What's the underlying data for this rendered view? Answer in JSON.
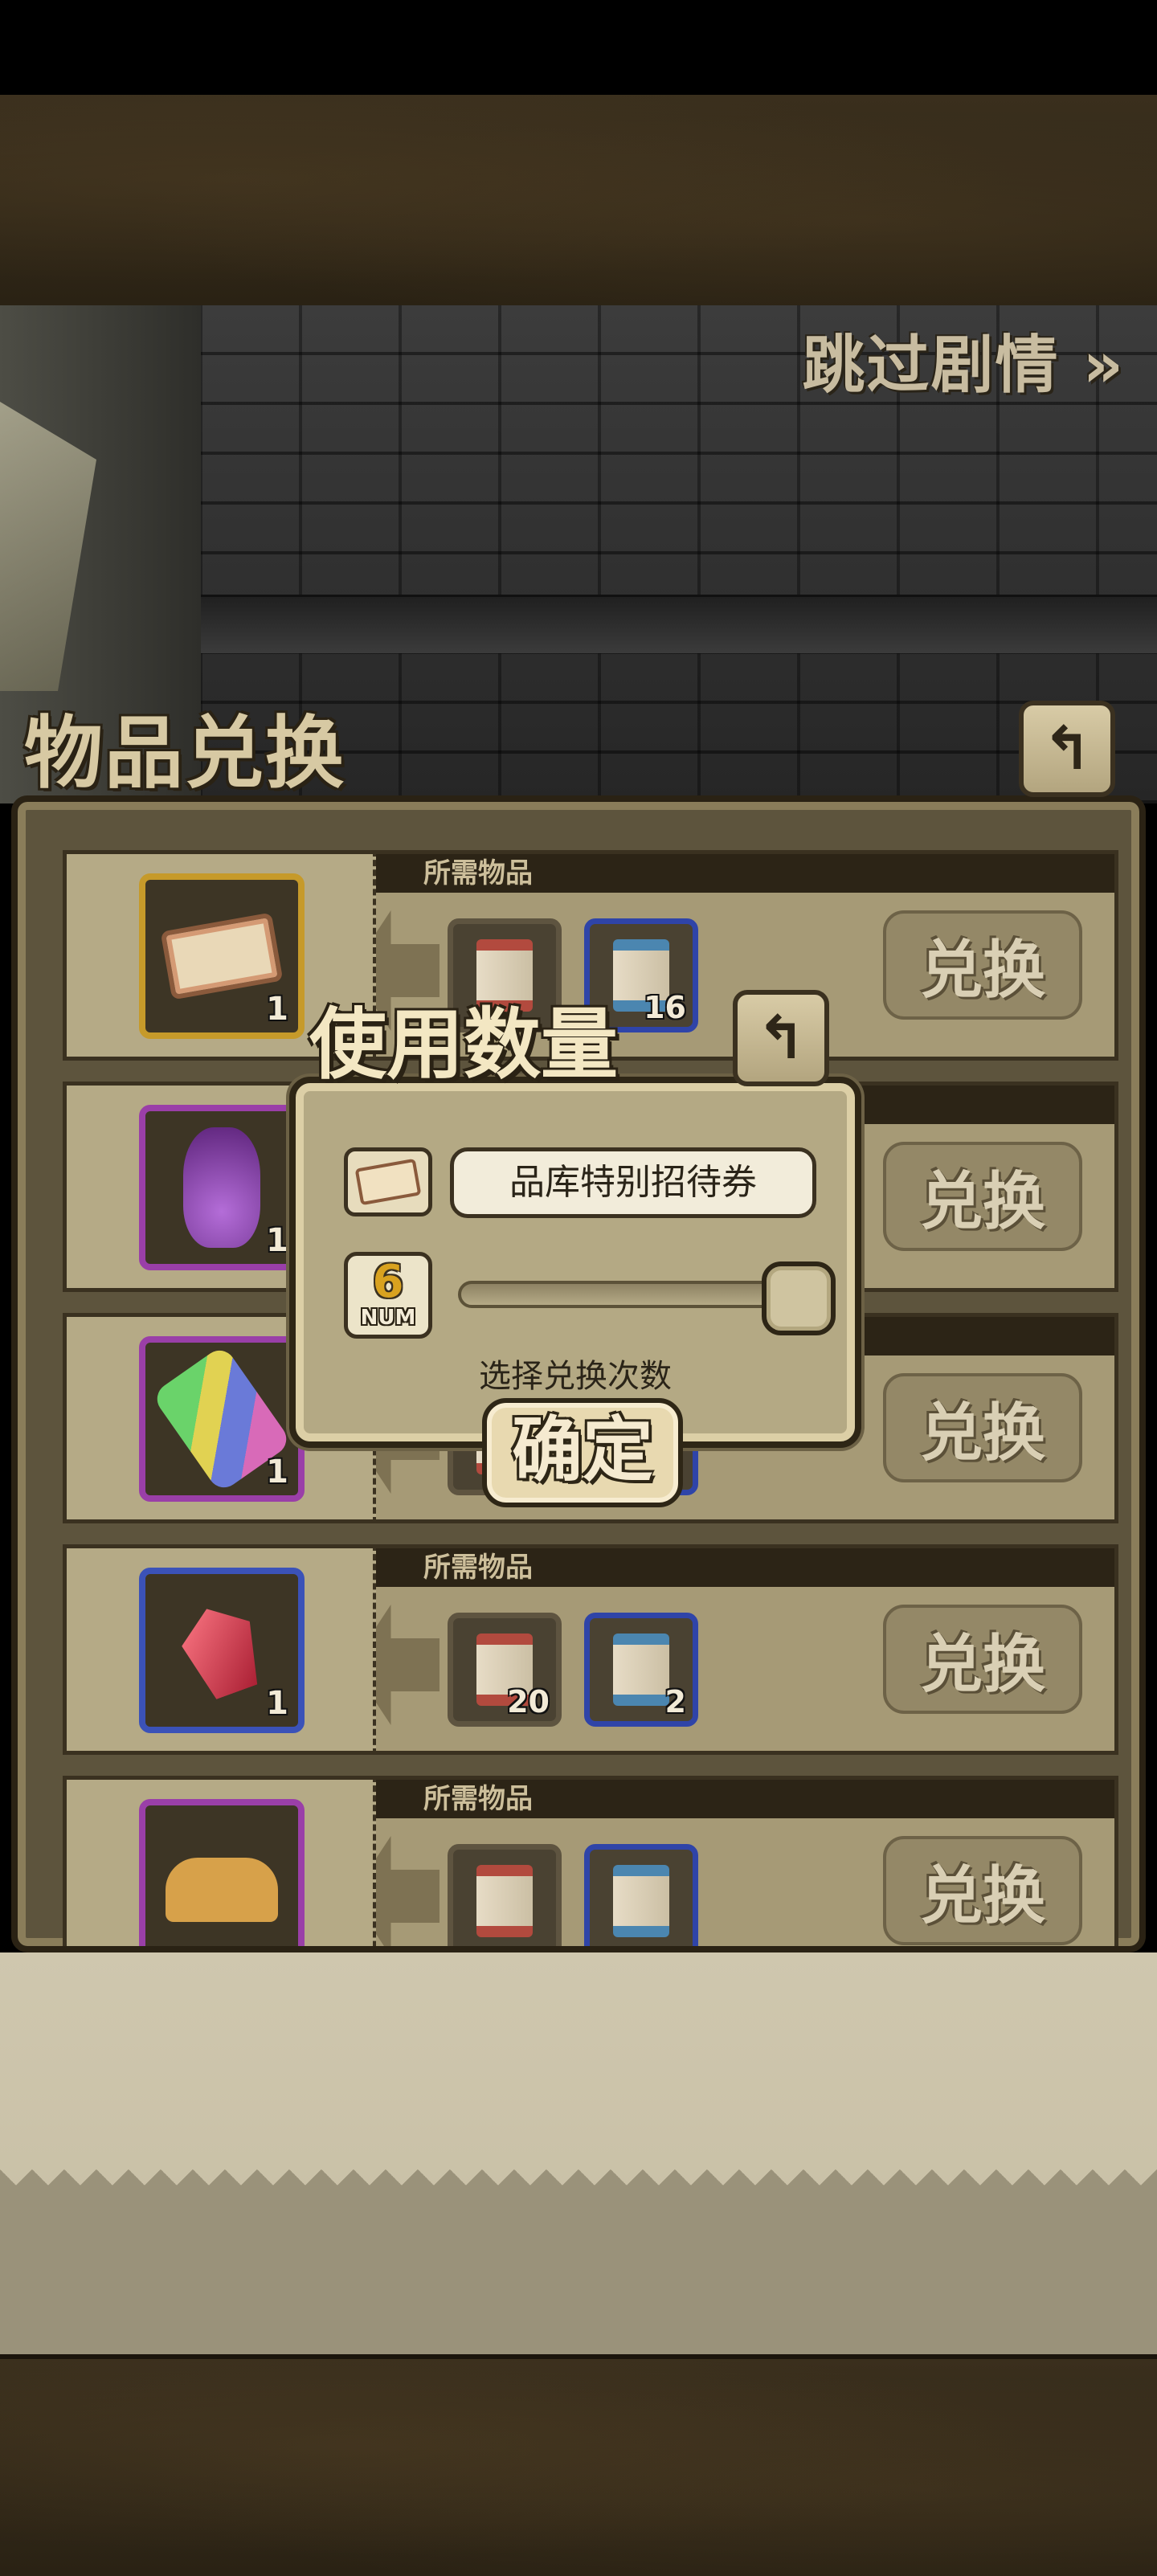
{
  "skip_label": "跳过剧情 »",
  "panel": {
    "title": "物品兑换",
    "back_icon": "return-arrow-icon",
    "required_label": "所需物品",
    "exchange_label": "兑换",
    "rows": [
      {
        "item": "ticket",
        "frame": "gold",
        "qty": "1",
        "req": [
          "",
          "16"
        ]
      },
      {
        "item": "vase",
        "frame": "purple",
        "qty": "1",
        "req": [
          "",
          ""
        ]
      },
      {
        "item": "popsicle",
        "frame": "purple",
        "qty": "1",
        "req": [
          "",
          ""
        ]
      },
      {
        "item": "gem",
        "frame": "blue",
        "qty": "1",
        "req": [
          "20",
          "2"
        ]
      },
      {
        "item": "bread",
        "frame": "purple",
        "qty": "",
        "req": [
          "",
          ""
        ]
      }
    ]
  },
  "modal": {
    "title": "使用数量",
    "item_name": "品库特别招待券",
    "count_value": "6",
    "count_label": "NUM",
    "slider_fraction": 1.0,
    "hint": "选择兑换次数",
    "confirm_label": "确定"
  }
}
